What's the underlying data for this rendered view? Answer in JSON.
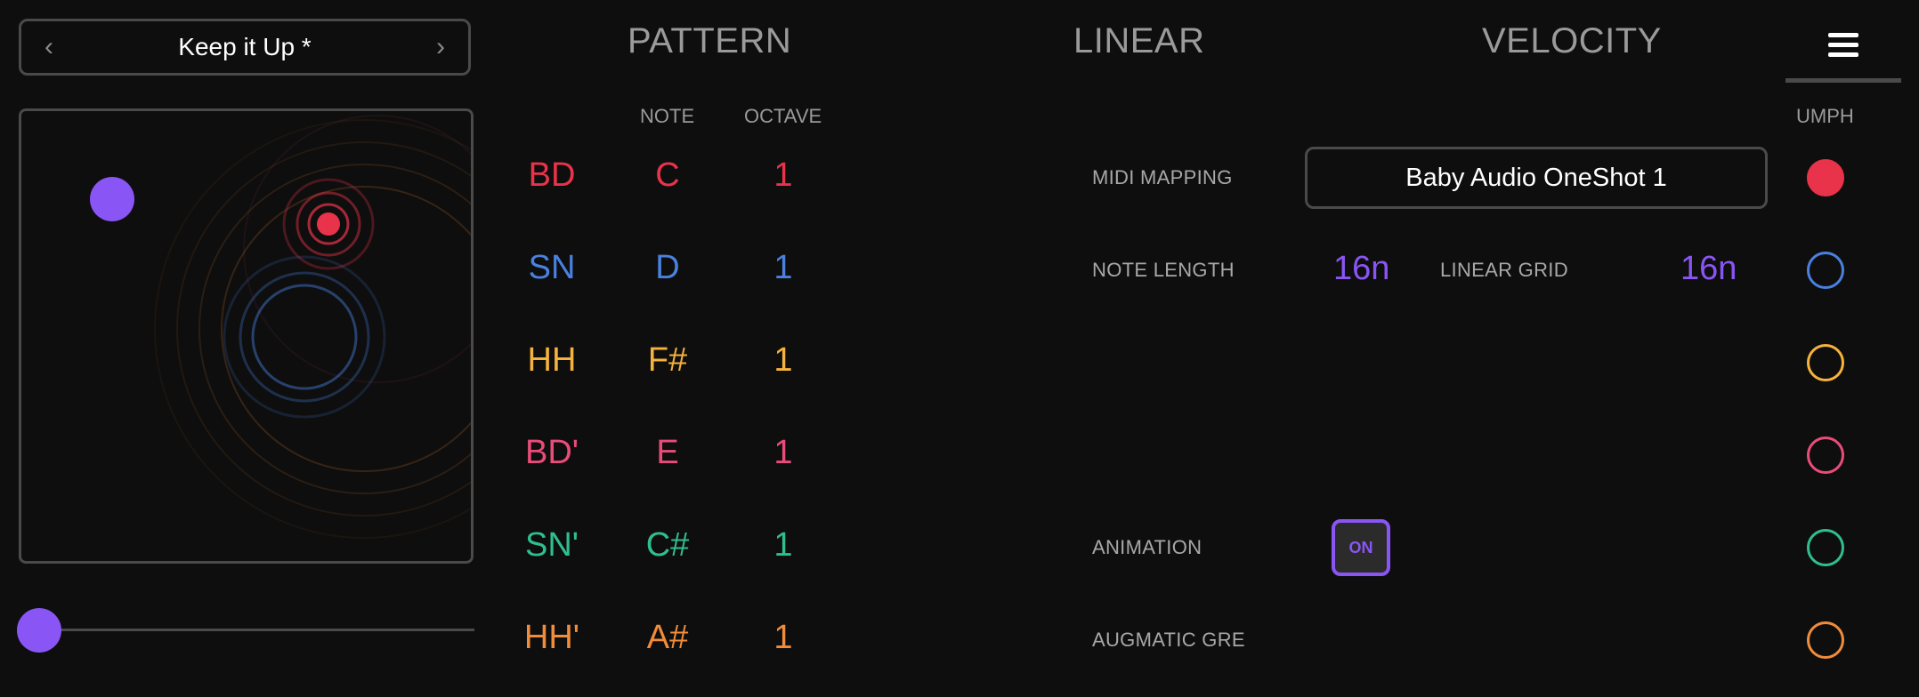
{
  "preset": {
    "prev_icon": "chevron-left-icon",
    "name": "Keep it Up *",
    "next_icon": "chevron-right-icon"
  },
  "tabs": [
    "PATTERN",
    "LINEAR",
    "VELOCITY"
  ],
  "menu_icon": "hamburger-menu-icon",
  "columns": {
    "note": "NOTE",
    "octave": "OCTAVE",
    "umph": "UMPH"
  },
  "colors": {
    "accent": "#8a55f5",
    "bd": "#e8334a",
    "sn": "#4a80e0",
    "hh": "#f5b23c",
    "bd2": "#ea4c7a",
    "sn2": "#2fbf8f",
    "hh2": "#f08c3a"
  },
  "rows": [
    {
      "name": "BD",
      "note": "C",
      "octave": "1",
      "color": "#e8334a",
      "umph_filled": true
    },
    {
      "name": "SN",
      "note": "D",
      "octave": "1",
      "color": "#4a80e0",
      "umph_filled": false
    },
    {
      "name": "HH",
      "note": "F#",
      "octave": "1",
      "color": "#f5b23c",
      "umph_filled": false
    },
    {
      "name": "BD'",
      "note": "E",
      "octave": "1",
      "color": "#ea4c7a",
      "umph_filled": false
    },
    {
      "name": "SN'",
      "note": "C#",
      "octave": "1",
      "color": "#2fbf8f",
      "umph_filled": false
    },
    {
      "name": "HH'",
      "note": "A#",
      "octave": "1",
      "color": "#f08c3a",
      "umph_filled": false
    }
  ],
  "settings": {
    "midi_mapping_label": "MIDI MAPPING",
    "midi_mapping_value": "Baby Audio OneShot 1",
    "note_length_label": "NOTE LENGTH",
    "note_length_value": "16n",
    "linear_grid_label": "LINEAR GRID",
    "linear_grid_value": "16n",
    "animation_label": "ANIMATION",
    "animation_value": "ON",
    "augmatic_label": "AUGMATIC GRE"
  },
  "slider": {
    "value_fraction": 0.0
  }
}
